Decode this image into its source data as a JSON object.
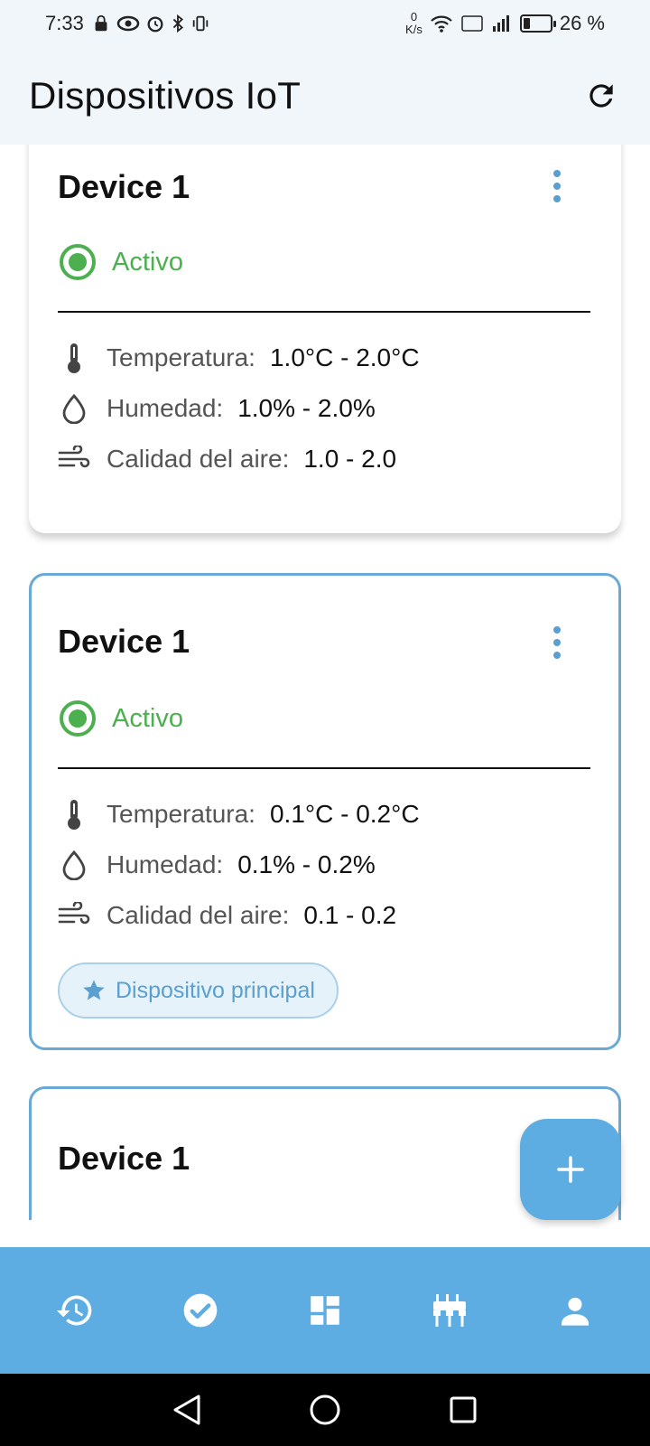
{
  "status_bar": {
    "time": "7:33",
    "net_speed_value": "0",
    "net_speed_unit": "K/s",
    "battery_percent": "26 %",
    "battery_level": 0.26
  },
  "app_bar": {
    "title": "Dispositivos IoT",
    "refresh_icon": "refresh-icon"
  },
  "devices": [
    {
      "name": "Device 1",
      "status": "Activo",
      "metrics": {
        "temperature": {
          "label": "Temperatura:",
          "value": "1.0°C - 2.0°C"
        },
        "humidity": {
          "label": "Humedad:",
          "value": "1.0% - 2.0%"
        },
        "air_quality": {
          "label": "Calidad del aire:",
          "value": "1.0 - 2.0"
        }
      }
    },
    {
      "name": "Device 1",
      "status": "Activo",
      "metrics": {
        "temperature": {
          "label": "Temperatura:",
          "value": "0.1°C - 0.2°C"
        },
        "humidity": {
          "label": "Humedad:",
          "value": "0.1% - 0.2%"
        },
        "air_quality": {
          "label": "Calidad del aire:",
          "value": "0.1 - 0.2"
        }
      },
      "chip_label": "Dispositivo principal"
    },
    {
      "name": "Device 1"
    }
  ],
  "fab": {
    "icon": "plus-icon"
  },
  "bottom_nav": {
    "items": [
      "history-icon",
      "check-circle-icon",
      "dashboard-icon",
      "devices-icon",
      "person-icon"
    ]
  },
  "colors": {
    "accent": "#5dade2",
    "active_green": "#4caf50",
    "header_bg": "#f1f6fa"
  }
}
